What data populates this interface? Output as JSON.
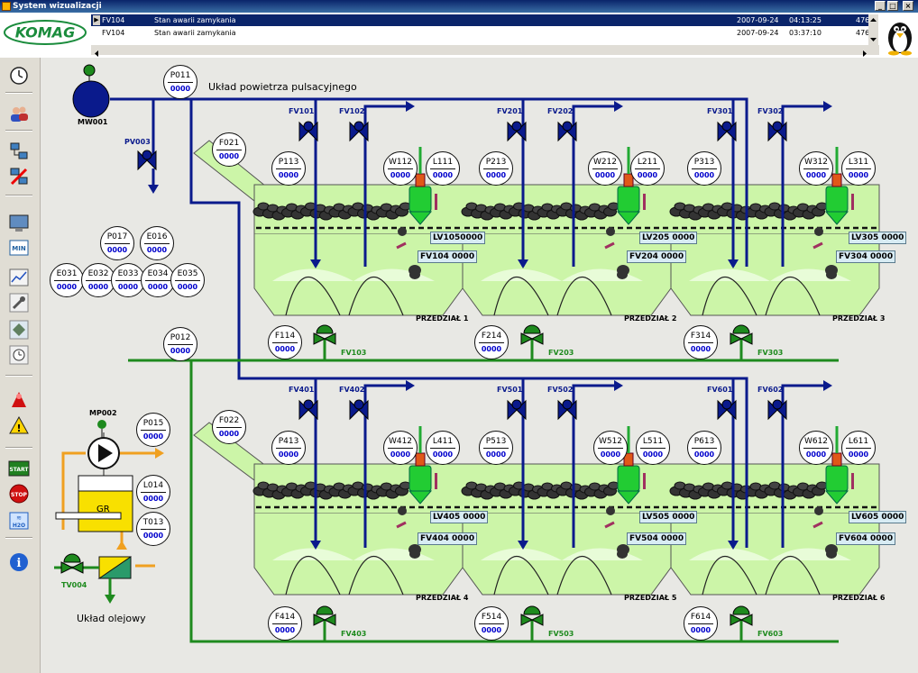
{
  "window": {
    "title": "System wizualizacji"
  },
  "alarms": [
    {
      "tag": "FV104",
      "message": "Stan awarii zamykania",
      "date": "2007-09-24",
      "time": "04:13:25",
      "count": "476",
      "selected": true
    },
    {
      "tag": "FV104",
      "message": "Stan awarii zamykania",
      "date": "2007-09-24",
      "time": "03:37:10",
      "count": "476",
      "selected": false
    }
  ],
  "logo": {
    "text": "KOMAG",
    "color": "#1a8c3c"
  },
  "colors": {
    "air": "#0a1a8c",
    "water": "#1e8a1e",
    "oil": "#f0a020",
    "chamber": "#ccf5a8",
    "valve_green": "#1e8a1e",
    "gauge_value": "#0000cc"
  },
  "sidebar": [
    {
      "name": "clock-icon"
    },
    {
      "name": "users-icon"
    },
    {
      "name": "network-icon"
    },
    {
      "name": "network-alarm-icon"
    },
    {
      "name": "monitor-icon"
    },
    {
      "name": "min-icon",
      "label": "MIN"
    },
    {
      "name": "trend-icon"
    },
    {
      "name": "wrench-icon"
    },
    {
      "name": "tool-icon"
    },
    {
      "name": "schedule-icon"
    },
    {
      "name": "alarm-red-icon"
    },
    {
      "name": "warning-icon"
    },
    {
      "name": "start-icon",
      "label": "START"
    },
    {
      "name": "stop-icon",
      "label": "STOP"
    },
    {
      "name": "water-icon",
      "label": "H2O"
    },
    {
      "name": "info-icon"
    }
  ],
  "plant": {
    "air_title": "Układ powietrza pulsacyjnego",
    "oil_title": "Układ olejowy",
    "blower": "MW001",
    "pump": "MP002",
    "tank": "GR",
    "gauges": [
      {
        "label": "P011",
        "value": "0000"
      },
      {
        "label": "F021",
        "value": "0000"
      },
      {
        "label": "P113",
        "value": "0000"
      },
      {
        "label": "W112",
        "value": "0000"
      },
      {
        "label": "L111",
        "value": "0000"
      },
      {
        "label": "P213",
        "value": "0000"
      },
      {
        "label": "W212",
        "value": "0000"
      },
      {
        "label": "L211",
        "value": "0000"
      },
      {
        "label": "P313",
        "value": "0000"
      },
      {
        "label": "W312",
        "value": "0000"
      },
      {
        "label": "L311",
        "value": "0000"
      },
      {
        "label": "P017",
        "value": "0000"
      },
      {
        "label": "E016",
        "value": "0000"
      },
      {
        "label": "E031",
        "value": "0000"
      },
      {
        "label": "E032",
        "value": "0000"
      },
      {
        "label": "E033",
        "value": "0000"
      },
      {
        "label": "E034",
        "value": "0000"
      },
      {
        "label": "E035",
        "value": "0000"
      },
      {
        "label": "P012",
        "value": "0000"
      },
      {
        "label": "F114",
        "value": "0000"
      },
      {
        "label": "F214",
        "value": "0000"
      },
      {
        "label": "F314",
        "value": "0000"
      },
      {
        "label": "F022",
        "value": "0000"
      },
      {
        "label": "P015",
        "value": "0000"
      },
      {
        "label": "P413",
        "value": "0000"
      },
      {
        "label": "W412",
        "value": "0000"
      },
      {
        "label": "L411",
        "value": "0000"
      },
      {
        "label": "P513",
        "value": "0000"
      },
      {
        "label": "W512",
        "value": "0000"
      },
      {
        "label": "L511",
        "value": "0000"
      },
      {
        "label": "P613",
        "value": "0000"
      },
      {
        "label": "W612",
        "value": "0000"
      },
      {
        "label": "L611",
        "value": "0000"
      },
      {
        "label": "L014",
        "value": "0000"
      },
      {
        "label": "T013",
        "value": "0000"
      },
      {
        "label": "F414",
        "value": "0000"
      },
      {
        "label": "F514",
        "value": "0000"
      },
      {
        "label": "F614",
        "value": "0000"
      }
    ],
    "air_valves": [
      "FV101",
      "FV102",
      "FV201",
      "FV202",
      "FV301",
      "FV302",
      "FV401",
      "FV402",
      "FV501",
      "FV502",
      "FV601",
      "FV602",
      "PV003"
    ],
    "water_valves": [
      "FV103",
      "FV203",
      "FV303",
      "FV403",
      "FV503",
      "FV603",
      "TV004"
    ],
    "chambers": [
      "PRZEDZIAŁ 1",
      "PRZEDZIAŁ 2",
      "PRZEDZIAŁ 3",
      "PRZEDZIAŁ 4",
      "PRZEDZIAŁ 5",
      "PRZEDZIAŁ 6"
    ],
    "tags": [
      "LV1050000",
      "FV104 0000",
      "LV205 0000",
      "FV204 0000",
      "LV305 0000",
      "FV304 0000",
      "LV405 0000",
      "FV404 0000",
      "LV505 0000",
      "FV504 0000",
      "LV605 0000",
      "FV604 0000"
    ]
  }
}
